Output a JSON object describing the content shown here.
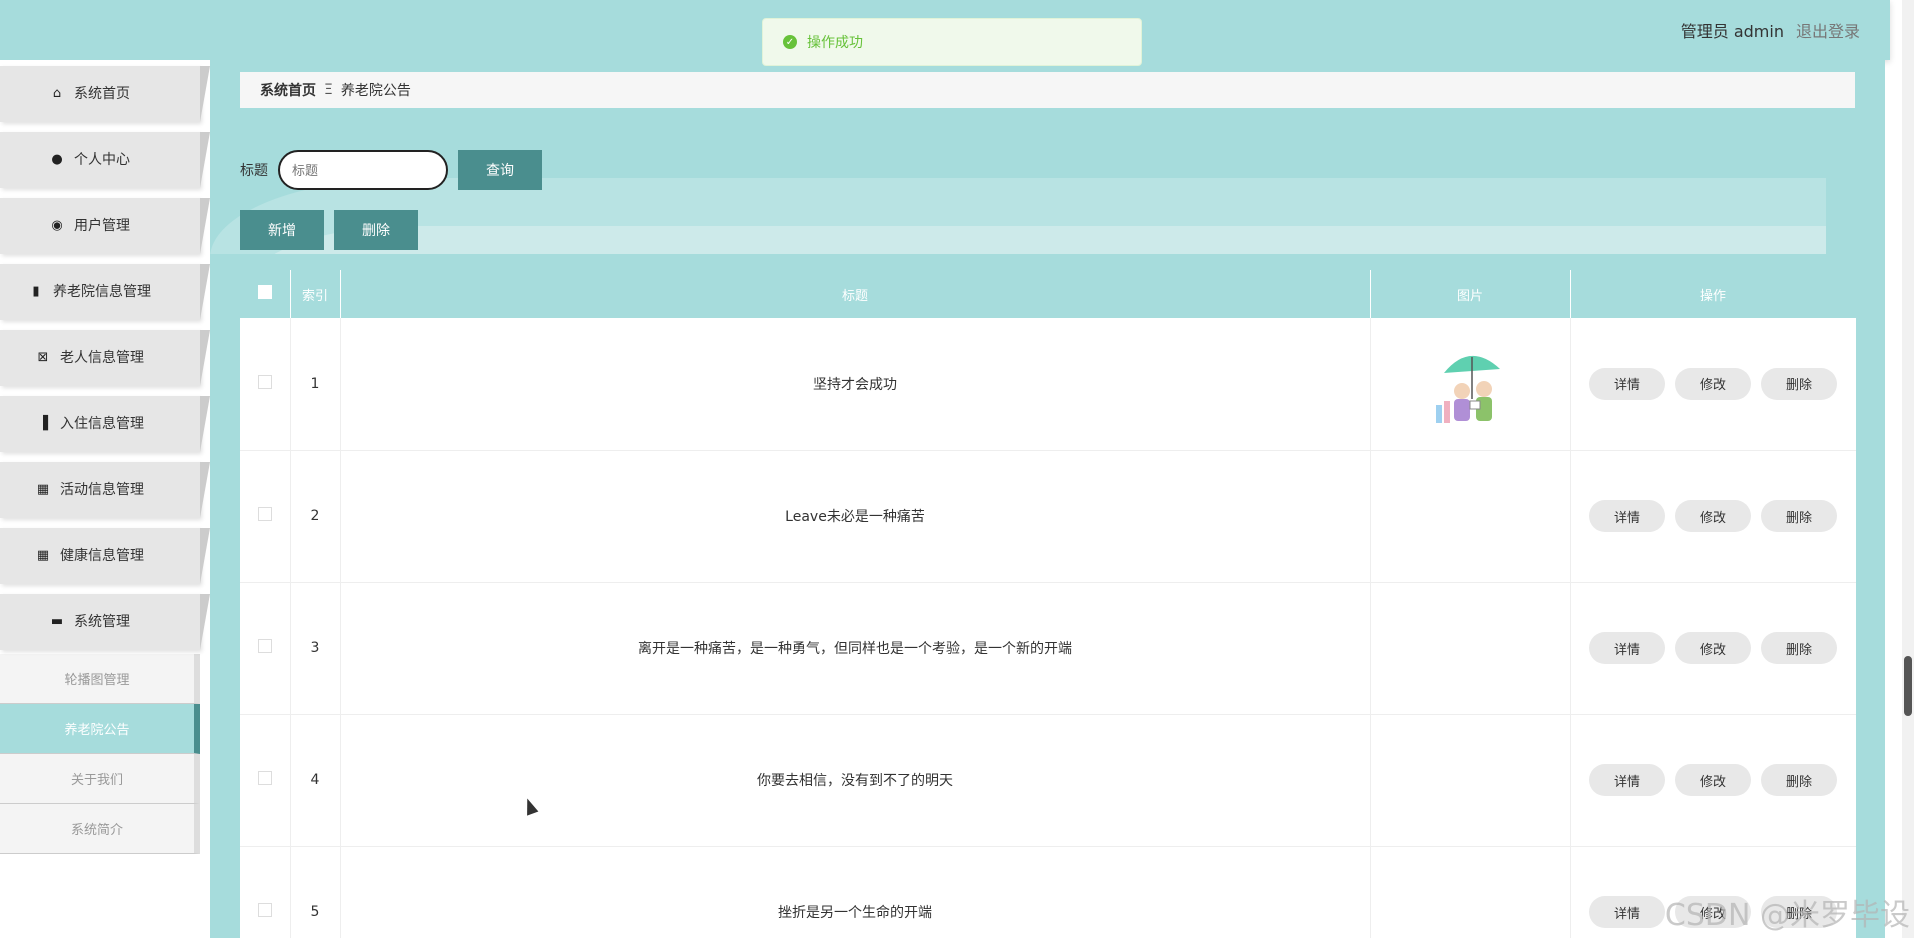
{
  "header": {
    "user_label": "管理员 admin",
    "logout_label": "退出登录"
  },
  "toast": {
    "message": "操作成功"
  },
  "sidebar": {
    "items": [
      {
        "label": "系统首页",
        "icon": "home-icon"
      },
      {
        "label": "个人中心",
        "icon": "user-icon"
      },
      {
        "label": "用户管理",
        "icon": "balloon-icon"
      },
      {
        "label": "养老院信息管理",
        "icon": "book-icon"
      },
      {
        "label": "老人信息管理",
        "icon": "clipboard-icon"
      },
      {
        "label": "入住信息管理",
        "icon": "bar-chart-icon"
      },
      {
        "label": "活动信息管理",
        "icon": "grid-icon"
      },
      {
        "label": "健康信息管理",
        "icon": "grid-icon"
      },
      {
        "label": "系统管理",
        "icon": "chat-icon"
      }
    ],
    "submenu": [
      {
        "label": "轮播图管理"
      },
      {
        "label": "养老院公告"
      },
      {
        "label": "关于我们"
      },
      {
        "label": "系统简介"
      }
    ]
  },
  "breadcrumb": {
    "home": "系统首页",
    "sep": "Ξ",
    "current": "养老院公告"
  },
  "search": {
    "label": "标题",
    "placeholder": "标题",
    "button": "查询"
  },
  "actions": {
    "add": "新增",
    "delete": "删除"
  },
  "table": {
    "columns": [
      "索引",
      "标题",
      "图片",
      "操作"
    ],
    "row_buttons": [
      "详情",
      "修改",
      "删除"
    ],
    "rows": [
      {
        "index": "1",
        "title": "坚持才会成功",
        "has_image": true
      },
      {
        "index": "2",
        "title": "Leave未必是一种痛苦",
        "has_image": false
      },
      {
        "index": "3",
        "title": "离开是一种痛苦，是一种勇气，但同样也是一个考验，是一个新的开端",
        "has_image": false
      },
      {
        "index": "4",
        "title": "你要去相信，没有到不了的明天",
        "has_image": false
      },
      {
        "index": "5",
        "title": "挫折是另一个生命的开端",
        "has_image": false
      }
    ]
  },
  "watermark": "CSDN @米罗毕设",
  "colors": {
    "accent": "#a6dcdc",
    "dark_button": "#4a8e8e",
    "toast_green": "#67c23a"
  }
}
